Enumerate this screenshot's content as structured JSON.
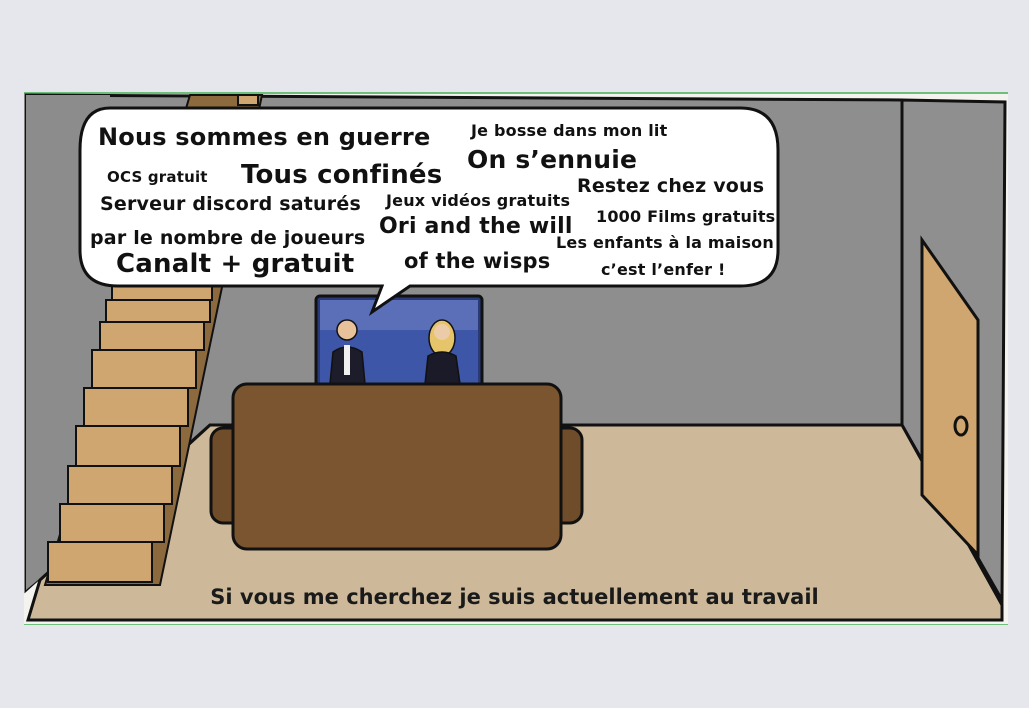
{
  "speech_bubble": {
    "phrases": [
      "Nous sommes en guerre",
      "Je bosse dans mon lit",
      "On s’ennuie",
      "OCS gratuit",
      "Tous confinés",
      "Restez chez vous",
      "Serveur discord saturés",
      "Jeux vidéos gratuits",
      "1000 Films gratuits",
      "par le nombre de joueurs",
      "Ori and the will",
      "Les enfants à la maison",
      "Canalt + gratuit",
      "of the wisps",
      "c’est l’enfer !"
    ]
  },
  "caption": "Si vous me cherchez je suis actuellement au travail",
  "colors": {
    "wall": "#8e8e8e",
    "floor": "#cdb99a",
    "stairs": "#cfa66f",
    "sofa": "#7a5530",
    "door": "#cfa66f",
    "outline": "#111111",
    "tv_screen": "#2a3a78"
  }
}
